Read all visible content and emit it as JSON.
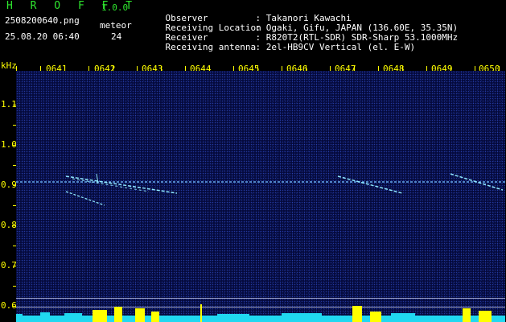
{
  "header": {
    "app_title": "H R O F F T",
    "version": "1.0.0",
    "filename": "2508200640.png",
    "datetime": "25.08.20 06:40",
    "meteor_label": "meteor",
    "meteor_count": "24"
  },
  "info": [
    {
      "key": "Observer",
      "value": ": Takanori Kawachi"
    },
    {
      "key": "Receiving Location",
      "value": ": Ogaki, Gifu, JAPAN (136.60E, 35.35N)"
    },
    {
      "key": "Receiver",
      "value": ": R820T2(RTL-SDR) SDR-Sharp 53.1000MHz"
    },
    {
      "key": "Receiving antenna",
      "value": ": 2el-HB9CV Vertical (el. E-W)"
    }
  ],
  "axis": {
    "y_unit": "kHz",
    "x_ticks": [
      "0641",
      "0642",
      "0643",
      "0644",
      "0645",
      "0646",
      "0647",
      "0648",
      "0649",
      "0650"
    ],
    "y_ticks": [
      "1.1",
      "1.0",
      "0.9",
      "0.8",
      "0.7",
      "0.6"
    ]
  },
  "colors": {
    "label_green": "#2ee62e",
    "text_white": "#ffffff",
    "axis_yellow": "#ffff00",
    "signal_cyan": "#8fe8ff",
    "background_blue": "#050a3c"
  }
}
